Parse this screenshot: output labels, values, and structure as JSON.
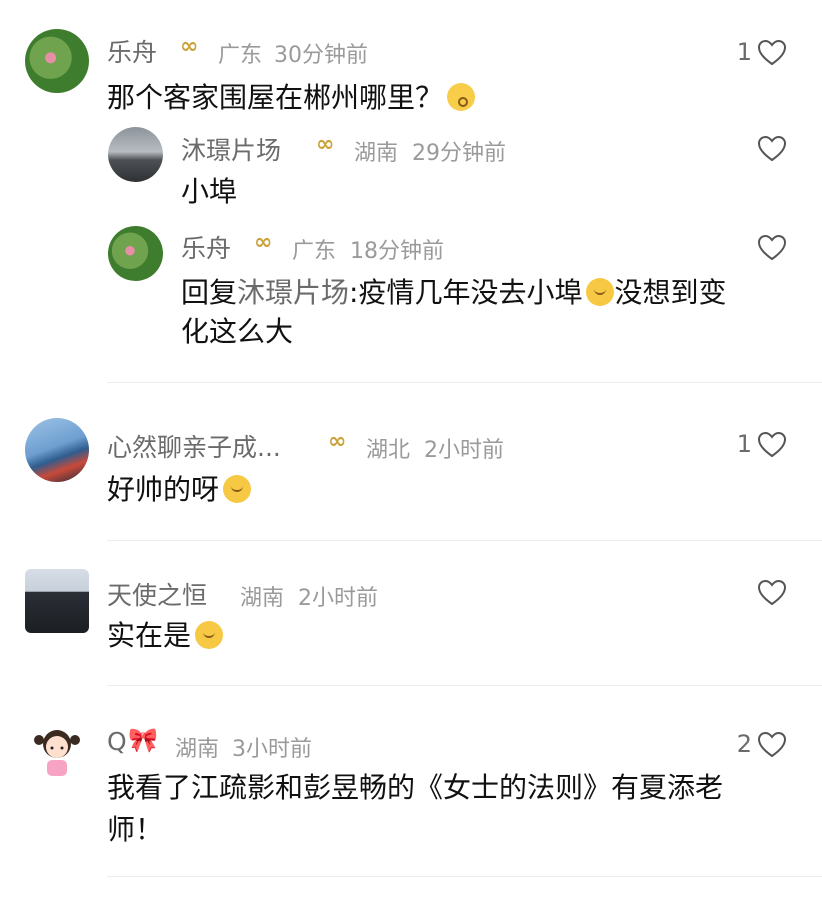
{
  "comments": [
    {
      "name": "乐舟",
      "has_badge": true,
      "region": "广东",
      "time": "30分钟前",
      "likes": "1",
      "text": "那个客家围屋在郴州哪里？",
      "replies": [
        {
          "name": "沐璟片场",
          "has_badge": true,
          "region": "湖南",
          "time": "29分钟前",
          "text": "小埠"
        },
        {
          "name": "乐舟",
          "has_badge": true,
          "region": "广东",
          "time": "18分钟前",
          "reply_prefix": "回复",
          "reply_target": "沐璟片场",
          "text_a": ":疫情几年没去小埠",
          "text_b": "没想到变",
          "text_c": "化这么大"
        }
      ]
    },
    {
      "name": "心然聊亲子成...",
      "has_badge": true,
      "region": "湖北",
      "time": "2小时前",
      "likes": "1",
      "text": "好帅的呀"
    },
    {
      "name": "天使之恒",
      "has_badge": false,
      "region": "湖南",
      "time": "2小时前",
      "text": "实在是"
    },
    {
      "name": "Q",
      "has_badge": false,
      "region": "湖南",
      "time": "3小时前",
      "likes": "2",
      "text_line1": "我看了江疏影和彭昱畅的《女士的法则》有夏添老",
      "text_line2": "师！"
    }
  ],
  "icons": {
    "badge": "infinity-badge-icon",
    "like": "heart-outline-icon"
  },
  "colors": {
    "badge": "#c9a23a",
    "muted": "#9a9a9a",
    "name": "#6b6b6b"
  }
}
